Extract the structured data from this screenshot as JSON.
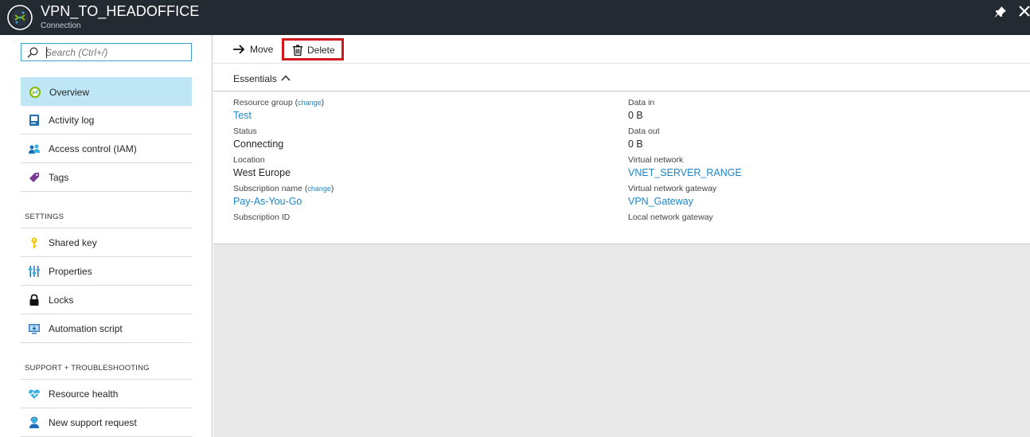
{
  "header": {
    "title": "VPN_TO_HEADOFFICE",
    "subtitle": "Connection"
  },
  "search": {
    "placeholder": "Search (Ctrl+/)"
  },
  "nav": {
    "items": [
      {
        "label": "Overview",
        "icon": "connection-icon",
        "active": true
      },
      {
        "label": "Activity log",
        "icon": "activity-log-icon"
      },
      {
        "label": "Access control (IAM)",
        "icon": "iam-users-icon"
      },
      {
        "label": "Tags",
        "icon": "tag-icon"
      }
    ],
    "settings_header": "SETTINGS",
    "settings_items": [
      {
        "label": "Shared key",
        "icon": "key-icon"
      },
      {
        "label": "Properties",
        "icon": "properties-sliders-icon"
      },
      {
        "label": "Locks",
        "icon": "lock-icon"
      },
      {
        "label": "Automation script",
        "icon": "automation-script-icon"
      }
    ],
    "support_header": "SUPPORT + TROUBLESHOOTING",
    "support_items": [
      {
        "label": "Resource health",
        "icon": "heart-pulse-icon"
      },
      {
        "label": "New support request",
        "icon": "support-person-icon"
      }
    ]
  },
  "toolbar": {
    "move_label": "Move",
    "delete_label": "Delete"
  },
  "essentials": {
    "label": "Essentials",
    "change_label": "change",
    "left": [
      {
        "label": "Resource group",
        "value": "Test",
        "link": true,
        "change": true
      },
      {
        "label": "Status",
        "value": "Connecting"
      },
      {
        "label": "Location",
        "value": "West Europe"
      },
      {
        "label": "Subscription name",
        "value": "Pay-As-You-Go",
        "link": true,
        "change": true
      },
      {
        "label": "Subscription ID",
        "value": ""
      }
    ],
    "right": [
      {
        "label": "Data in",
        "value": "0 B"
      },
      {
        "label": "Data out",
        "value": "0 B"
      },
      {
        "label": "Virtual network",
        "value": "VNET_SERVER_RANGE",
        "link": true
      },
      {
        "label": "Virtual network gateway",
        "value": "VPN_Gateway",
        "link": true
      },
      {
        "label": "Local network gateway",
        "value": ""
      }
    ]
  },
  "colors": {
    "titlebar_bg": "#242a32",
    "active_nav_bg": "#bfe6f5",
    "link": "#1b86c9",
    "delete_highlight": "#d0181f"
  }
}
